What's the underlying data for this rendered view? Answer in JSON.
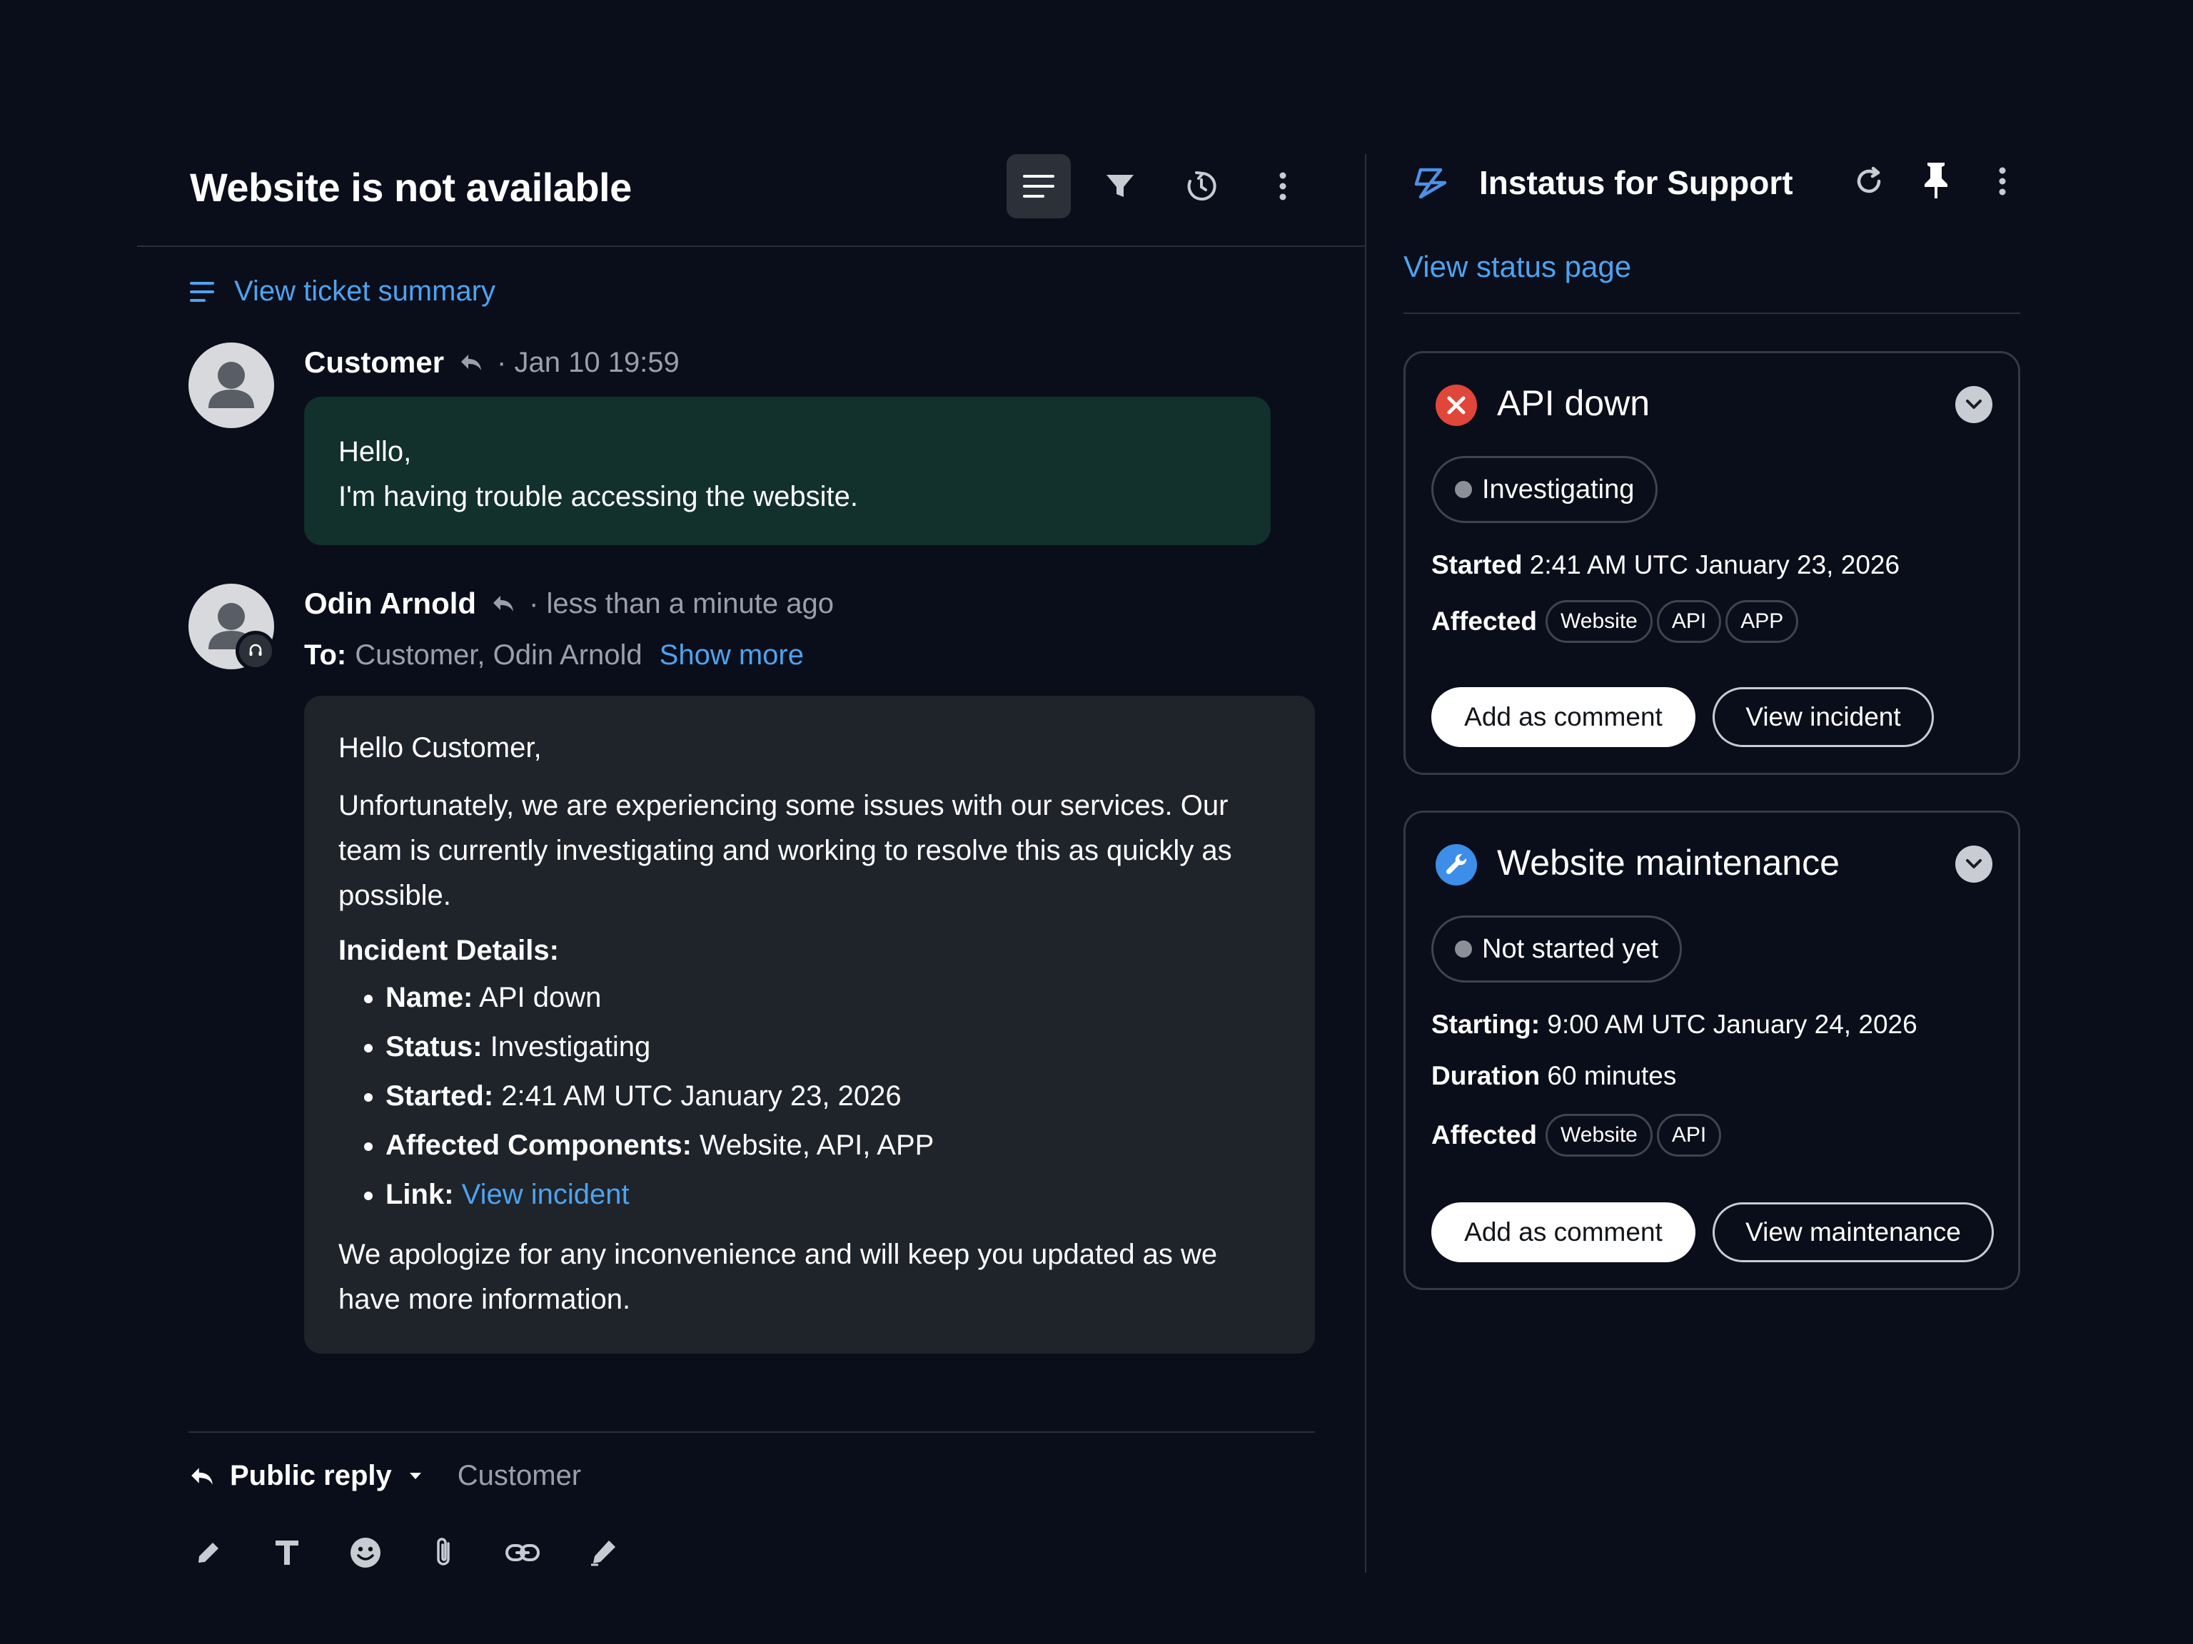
{
  "ticket": {
    "title": "Website is not available",
    "summary_link": "View ticket summary"
  },
  "messages": [
    {
      "author": "Customer",
      "meta": "· Jan 10 19:59",
      "body_lines": [
        "Hello,",
        "I'm having trouble accessing the website."
      ]
    },
    {
      "author": "Odin Arnold",
      "meta": "· less than a minute ago",
      "to_label": "To:",
      "to_value": "Customer, Odin Arnold",
      "show_more": "Show more",
      "greeting": "Hello Customer,",
      "paragraph": "Unfortunately, we are experiencing some issues with our services. Our team is currently investigating and working to resolve this as quickly as possible.",
      "details_heading": "Incident Details:",
      "details": [
        {
          "label": "Name:",
          "value": "API down"
        },
        {
          "label": "Status:",
          "value": "Investigating"
        },
        {
          "label": "Started:",
          "value": "2:41 AM UTC January 23, 2026"
        },
        {
          "label": "Affected Components:",
          "value": "Website, API, APP"
        },
        {
          "label": "Link:",
          "value": "View incident"
        }
      ],
      "closing": "We apologize for any inconvenience and will keep you updated as we have more information."
    }
  ],
  "reply": {
    "mode": "Public reply",
    "recipient": "Customer"
  },
  "panel": {
    "title": "Instatus for Support",
    "status_link": "View status page",
    "incidents": [
      {
        "title": "API down",
        "status": "Investigating",
        "started_label": "Started",
        "started_value": "2:41 AM UTC January 23, 2026",
        "affected_label": "Affected",
        "tags": [
          "Website",
          "API",
          "APP"
        ],
        "primary_button": "Add as comment",
        "secondary_button": "View incident"
      },
      {
        "title": "Website maintenance",
        "status": "Not started yet",
        "starting_label": "Starting:",
        "starting_value": "9:00 AM UTC January 24, 2026",
        "duration_label": "Duration",
        "duration_value": "60 minutes",
        "affected_label": "Affected",
        "tags": [
          "Website",
          "API"
        ],
        "primary_button": "Add as comment",
        "secondary_button": "View maintenance"
      }
    ]
  },
  "icons": {
    "toolbar": [
      "conversation-view-icon",
      "filter-icon",
      "history-icon",
      "more-vertical-icon"
    ],
    "panel": [
      "instatus-logo-icon",
      "refresh-icon",
      "pin-icon",
      "more-vertical-icon"
    ],
    "composer": [
      "pencil-icon",
      "text-format-icon",
      "emoji-icon",
      "attachment-icon",
      "link-icon",
      "signature-icon"
    ]
  },
  "colors": {
    "background": "#0a0e1a",
    "accent": "#4da3f0",
    "customer_bubble": "#12302c",
    "agent_bubble": "#1f232a",
    "incident_red": "#e0473a",
    "maintenance_blue": "#3c8ee8"
  }
}
